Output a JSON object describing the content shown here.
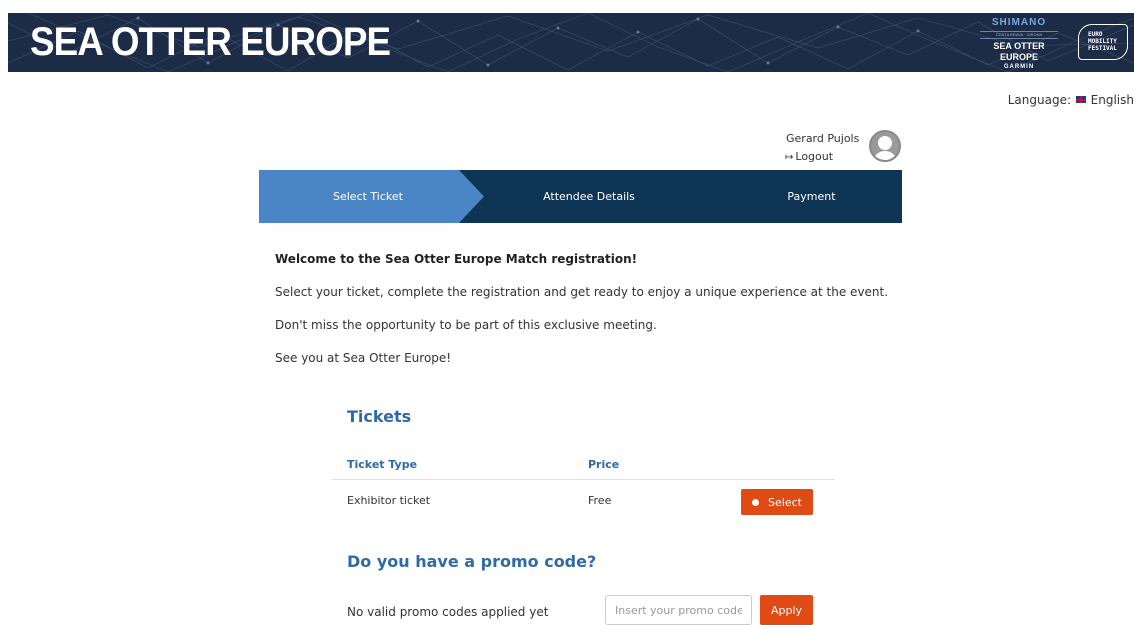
{
  "banner": {
    "title": "SEA OTTER EUROPE",
    "logo_sponsor_top": "SHIMANO",
    "logo_sponsor_small": "COSTA BRAVA · GIRONA",
    "logo_sponsor_event": "SEA OTTER EUROPE",
    "logo_sponsor_bottom": "GARMIN",
    "festival_line1": "EURO",
    "festival_line2": "MOBILITY",
    "festival_line3": "FESTIVAL",
    "background_color": "#1b2a44"
  },
  "language": {
    "label": "Language:",
    "flag_icon": "uk-flag-icon",
    "value": "English"
  },
  "user": {
    "name": "Gerard Pujols",
    "logout_icon": "sign-out-icon",
    "logout_label": "Logout",
    "avatar_icon": "user-avatar-icon"
  },
  "steps": [
    {
      "label": "Select Ticket",
      "active": true
    },
    {
      "label": "Attendee Details",
      "active": false
    },
    {
      "label": "Payment",
      "active": false
    }
  ],
  "colors": {
    "steps_active": "#4a86c5",
    "steps_inactive": "#0e3554",
    "accent_blue": "#2e6aa8",
    "button_orange": "#e04a14"
  },
  "welcome": {
    "title": "Welcome to the Sea Otter Europe Match registration!",
    "line1": "Select your ticket, complete the registration and get ready to enjoy a unique experience at the event.",
    "line2": "Don't miss the opportunity to be part of this exclusive meeting.",
    "line3": "See you at Sea Otter Europe!"
  },
  "tickets": {
    "title": "Tickets",
    "columns": [
      "Ticket Type",
      "Price"
    ],
    "rows": [
      {
        "type": "Exhibitor ticket",
        "price": "Free",
        "action": "Select"
      }
    ]
  },
  "promo": {
    "title": "Do you have a promo code?",
    "status": "No valid promo codes applied yet",
    "placeholder": "Insert your promo code",
    "apply_label": "Apply"
  }
}
